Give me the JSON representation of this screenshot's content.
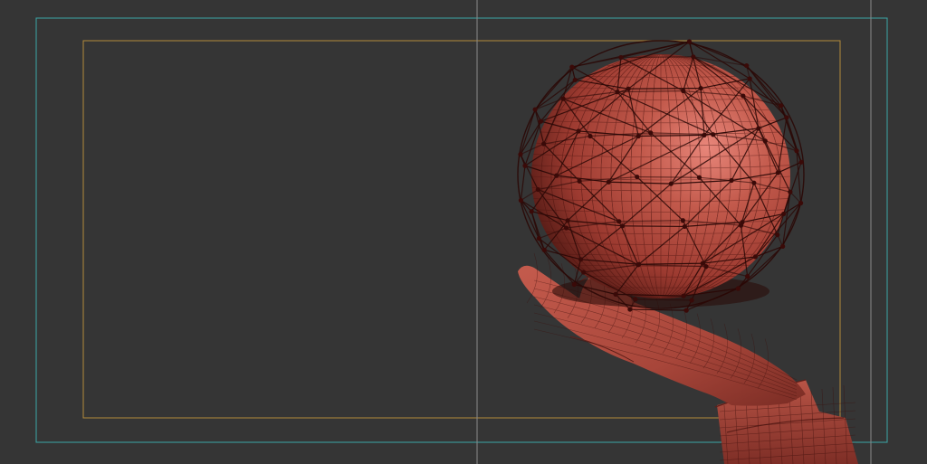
{
  "viewport": {
    "background": "#353535",
    "safe_frame_color": "#3aa6a8",
    "render_region_color": "#b38a3a",
    "center_line_color": "#8a8a8a"
  },
  "model": {
    "base_color": "#b54b3e",
    "highlight_color": "#e07a68",
    "shadow_color": "#4a1612",
    "wire_color": "#3a0d0a",
    "cage_color": "#2a0806",
    "objects": [
      {
        "name": "sphere",
        "icon": "sphere-mesh-icon"
      },
      {
        "name": "control-cage",
        "icon": "wireframe-cage-icon"
      },
      {
        "name": "hand",
        "icon": "hand-mesh-icon"
      }
    ]
  }
}
